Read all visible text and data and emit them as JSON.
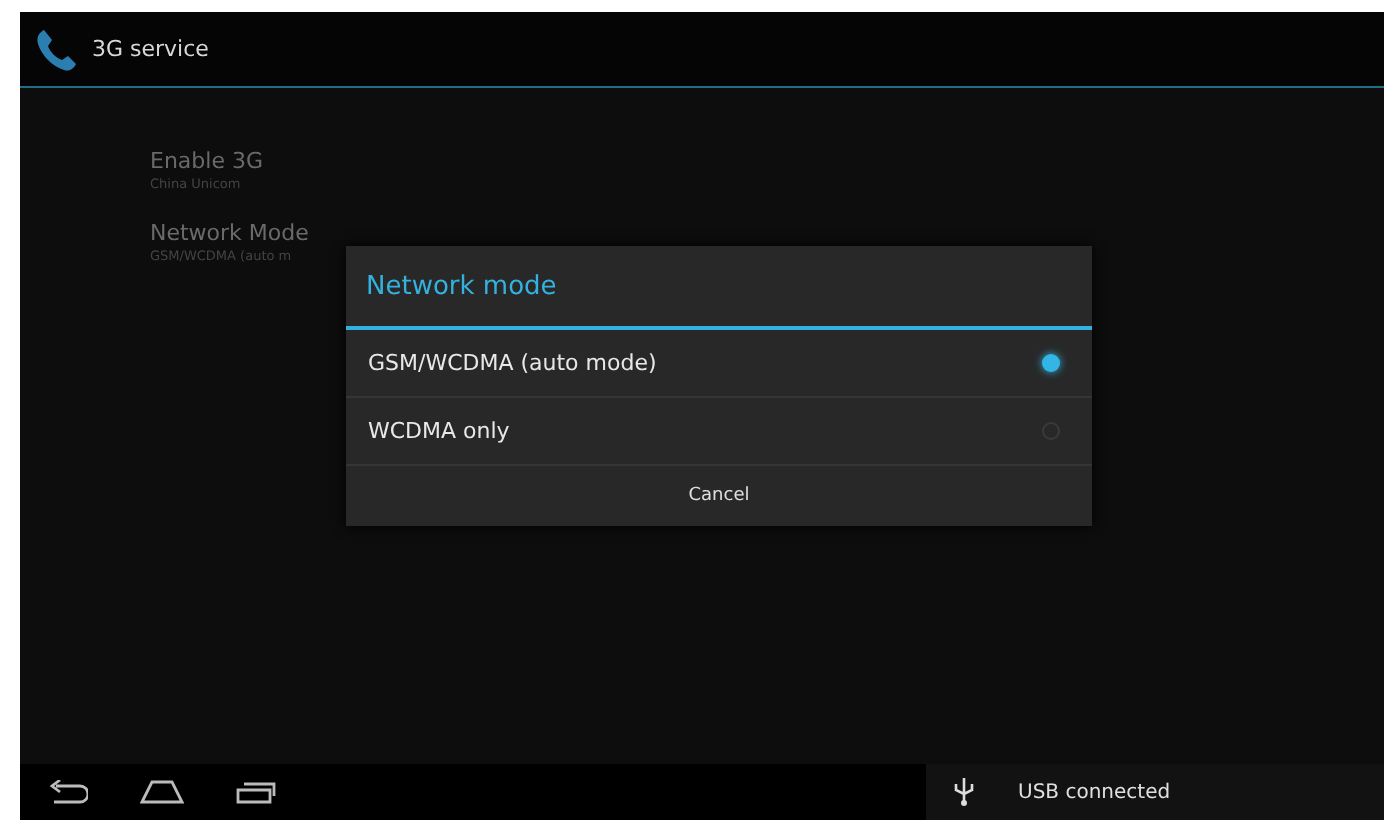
{
  "action_bar": {
    "title": "3G service"
  },
  "settings": [
    {
      "title": "Enable 3G",
      "summary": "China Unicom"
    },
    {
      "title": "Network Mode",
      "summary": "GSM/WCDMA (auto m"
    }
  ],
  "dialog": {
    "title": "Network mode",
    "options": [
      {
        "label": "GSM/WCDMA (auto mode)",
        "selected": true
      },
      {
        "label": "WCDMA only",
        "selected": false
      }
    ],
    "button": "Cancel"
  },
  "notification": {
    "text": "USB connected"
  }
}
